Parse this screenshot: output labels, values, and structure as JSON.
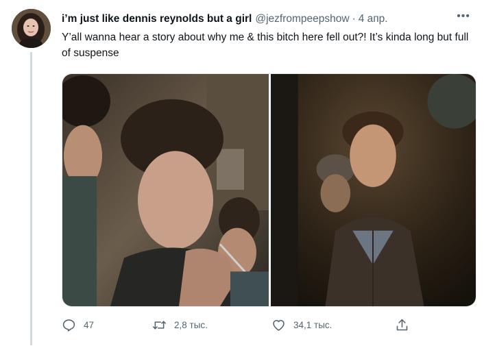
{
  "tweet": {
    "display_name": "i’m just like dennis reynolds but a girl",
    "handle": "@jezfrompeepshow",
    "separator": "·",
    "date": "4 апр.",
    "more_icon": "more-horizontal-icon",
    "more_label": "•••",
    "text": "Y’all wanna hear a story about why me & this bitch here fell out?! It’s kinda long but full of suspense",
    "media": [
      {
        "type": "photo",
        "description_icon": "photo-left"
      },
      {
        "type": "photo",
        "description_icon": "photo-right"
      }
    ]
  },
  "actions": {
    "reply": {
      "icon": "reply-icon",
      "count": "47"
    },
    "retweet": {
      "icon": "retweet-icon",
      "count": "2,8 тыс."
    },
    "like": {
      "icon": "heart-icon",
      "count": "34,1 тыс."
    },
    "share": {
      "icon": "share-icon"
    }
  },
  "colors": {
    "text_primary": "#0f1419",
    "text_secondary": "#536471",
    "thread_line": "#cfd9de"
  }
}
